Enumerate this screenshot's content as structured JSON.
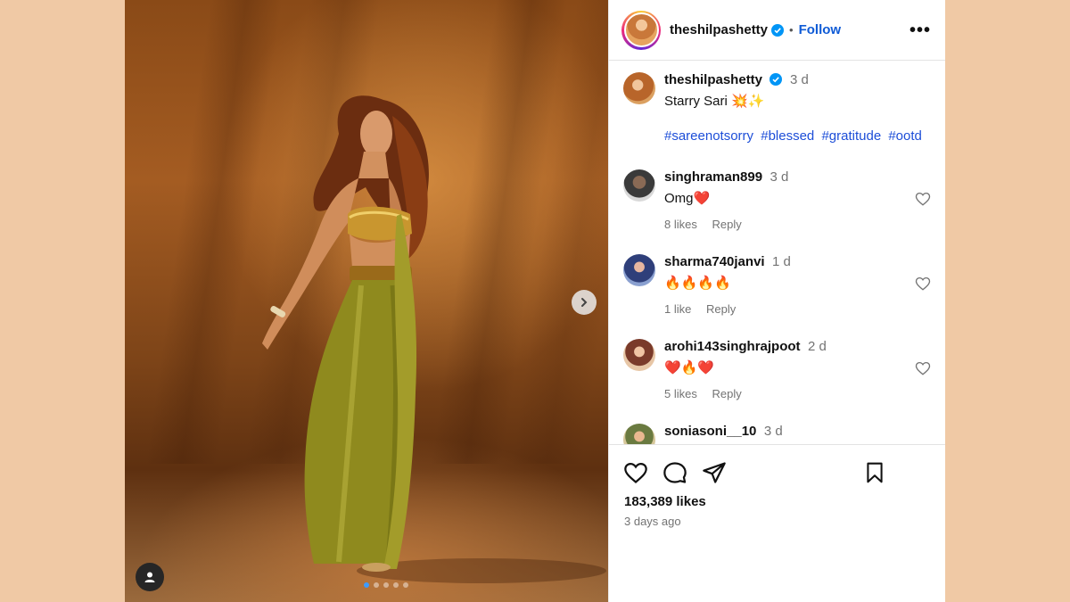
{
  "post": {
    "author": "theshilpashetty",
    "follow_label": "Follow",
    "separator": "•",
    "more_label": "•••",
    "caption": {
      "username": "theshilpashetty",
      "time": "3 d",
      "text": "Starry Sari 💥✨",
      "hashtags": [
        "#sareenotsorry",
        "#blessed",
        "#gratitude",
        "#ootd"
      ]
    },
    "comments": [
      {
        "username": "singhraman899",
        "time": "3 d",
        "text": "Omg❤️",
        "likes": "8 likes",
        "reply": "Reply"
      },
      {
        "username": "sharma740janvi",
        "time": "1 d",
        "text": "🔥🔥🔥🔥",
        "likes": "1 like",
        "reply": "Reply"
      },
      {
        "username": "arohi143singhrajpoot",
        "time": "2 d",
        "text": "❤️🔥❤️",
        "likes": "5 likes",
        "reply": "Reply"
      },
      {
        "username": "soniasoni__10",
        "time": "3 d",
        "text": "",
        "likes": "",
        "reply": ""
      }
    ],
    "like_count": "183,389 likes",
    "posted": "3 days ago",
    "carousel": {
      "slides": 5,
      "current": 1
    }
  },
  "colors": {
    "background": "#F0C9A5",
    "link": "#0f5bd6",
    "hashtag": "#1d4ed8",
    "verified": "#0095f6",
    "active_dot": "#3d9bff"
  }
}
